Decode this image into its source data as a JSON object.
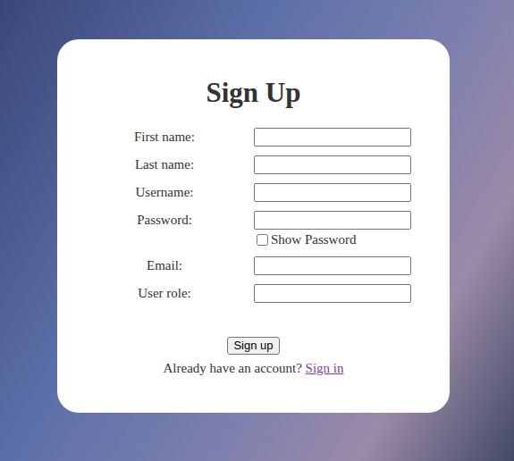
{
  "form": {
    "title": "Sign Up",
    "fields": [
      {
        "label": "First name:",
        "value": "",
        "kind": "text"
      },
      {
        "label": "Last name:",
        "value": "",
        "kind": "text"
      },
      {
        "label": "Username:",
        "value": "",
        "kind": "text"
      },
      {
        "label": "Password:",
        "value": "",
        "kind": "password"
      },
      {
        "label": "Email:",
        "value": "",
        "kind": "text"
      },
      {
        "label": "User role:",
        "value": "",
        "kind": "text"
      }
    ],
    "show_password": {
      "label": "Show Password",
      "checked": false
    },
    "submit": "Sign up",
    "footer": {
      "text": "Already have an account?",
      "link": "Sign in"
    }
  }
}
